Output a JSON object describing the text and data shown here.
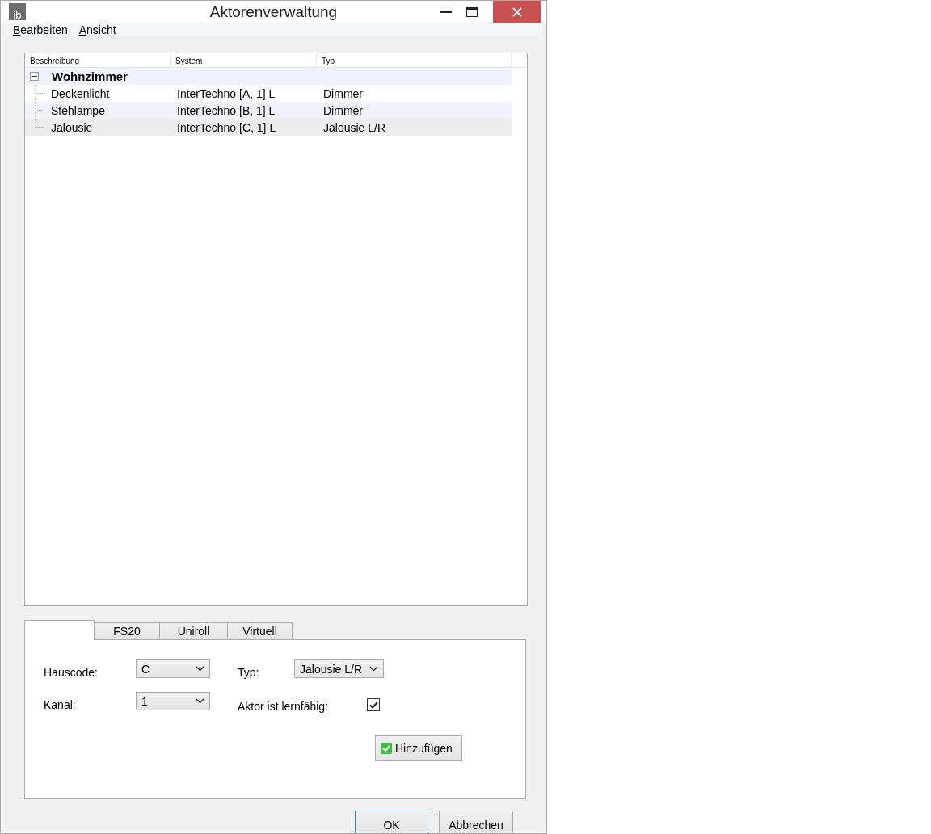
{
  "window": {
    "title": "Aktorenverwaltung",
    "app_icon": "jb"
  },
  "menu": [
    "Bearbeiten",
    "Ansicht"
  ],
  "tree": {
    "columns": [
      "Beschreibung",
      "System",
      "Typ"
    ],
    "groups": [
      {
        "label": "Wohnzimmer",
        "expanded": true,
        "children": [
          {
            "name": "Deckenlicht",
            "system": "InterTechno [A, 1] L",
            "type": "Dimmer",
            "selected": false
          },
          {
            "name": "Stehlampe",
            "system": "InterTechno [B, 1] L",
            "type": "Dimmer",
            "selected": false
          },
          {
            "name": "Jalousie",
            "system": "InterTechno [C, 1] L",
            "type": "Jalousie L/R",
            "selected": true
          }
        ]
      }
    ]
  },
  "tabs": [
    {
      "selected": true
    },
    {
      "label": "FS20",
      "selected": false
    },
    {
      "label": "Uniroll",
      "selected": false
    },
    {
      "label": "Virtuell",
      "selected": false
    }
  ],
  "form": {
    "hauscode_label": "Hauscode:",
    "hauscode": "C",
    "kanal_label": "Kanal:",
    "kanal": "1",
    "typ_label": "Typ:",
    "typ": "Jalousie L/R",
    "learnable_label": "Aktor ist lernfähig:",
    "learnable": true,
    "add_button": "Hinzufügen"
  },
  "buttons": [
    {
      "label": "OK",
      "default": true
    },
    {
      "label": "Abbrechen",
      "default": false
    }
  ]
}
